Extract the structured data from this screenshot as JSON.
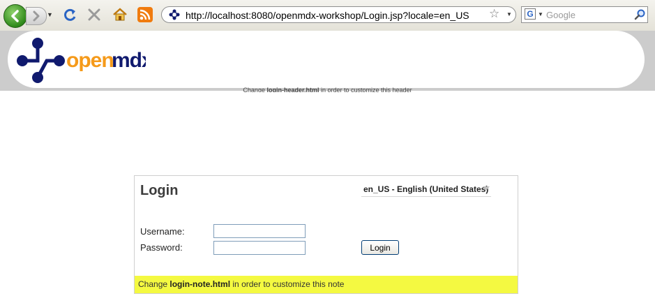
{
  "browser": {
    "url": "http://localhost:8080/openmdx-workshop/Login.jsp?locale=en_US",
    "search_placeholder": "Google",
    "icons": [
      "back-icon",
      "forward-icon",
      "reload-icon",
      "stop-icon",
      "home-icon",
      "rss-icon",
      "site-icon",
      "bookmark-star-icon",
      "google-icon",
      "search-icon"
    ]
  },
  "header": {
    "logo_text": "openmdx",
    "note_prefix": "Change",
    "note_file": "login-header.html",
    "note_suffix": "in order to customize this header"
  },
  "login": {
    "title": "Login",
    "locale_selected": "en_US - English (United States)",
    "username_label": "Username:",
    "password_label": "Password:",
    "username_value": "",
    "password_value": "",
    "login_button": "Login",
    "note_prefix": "Change",
    "note_file": "login-note.html",
    "note_suffix": "in order to customize this note"
  },
  "colors": {
    "logo_navy": "#101a6e",
    "logo_orange": "#f59a1a",
    "note_bg": "#f4f941",
    "header_band": "#cccccc"
  }
}
